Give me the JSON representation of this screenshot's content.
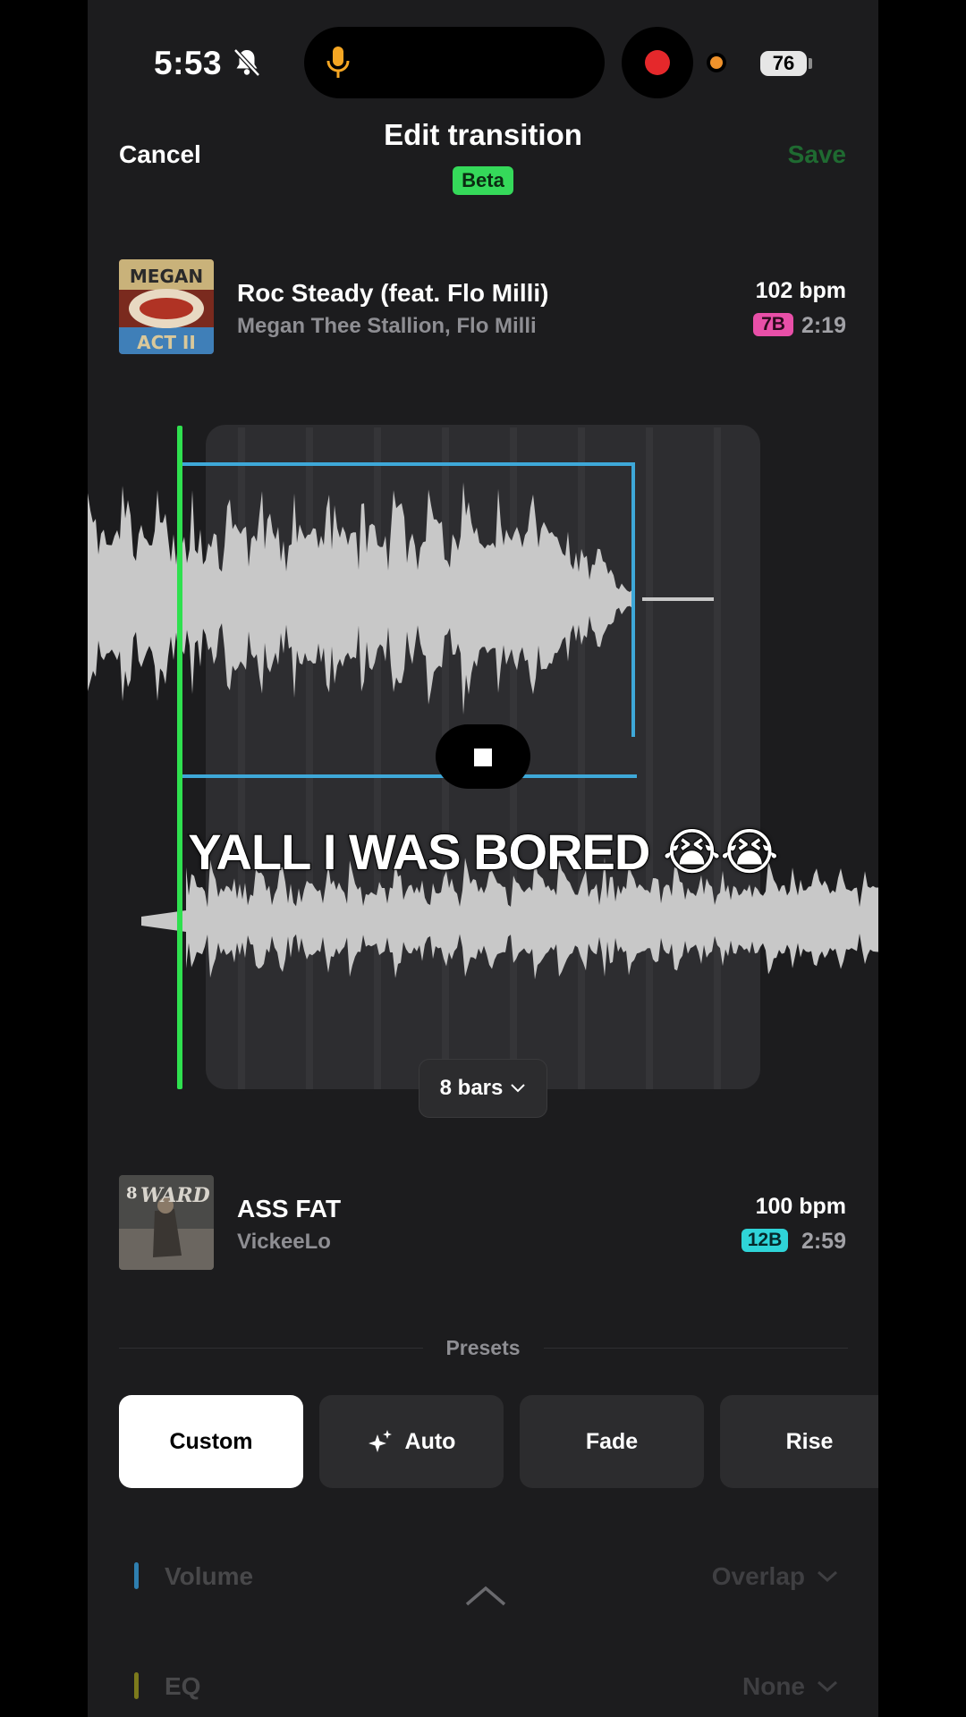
{
  "status_bar": {
    "time": "5:53",
    "battery": "76"
  },
  "header": {
    "cancel_label": "Cancel",
    "title": "Edit transition",
    "badge": "Beta",
    "save_label": "Save"
  },
  "track_out": {
    "title": "Roc Steady (feat. Flo Milli)",
    "artist": "Megan Thee Stallion, Flo Milli",
    "bpm": "102 bpm",
    "key": "7B",
    "key_color": "#e84fa8",
    "duration": "2:19"
  },
  "track_in": {
    "title": "ASS FAT",
    "artist": "VickeeLo",
    "bpm": "100 bpm",
    "key": "12B",
    "key_color": "#2fd4d8",
    "duration": "2:59"
  },
  "transition": {
    "caption": "YALL I WAS BORED 😭😭",
    "length_label": "8 bars"
  },
  "presets": {
    "label": "Presets",
    "items": [
      {
        "label": "Custom",
        "active": true
      },
      {
        "label": "Auto",
        "icon": "sparkle-icon",
        "active": false
      },
      {
        "label": "Fade",
        "active": false
      },
      {
        "label": "Rise",
        "active": false
      }
    ]
  },
  "controls": [
    {
      "label": "Volume",
      "value": "Overlap",
      "color": "#2f7fb0"
    },
    {
      "label": "EQ",
      "value": "None",
      "color": "#7c7a1c"
    }
  ],
  "colors": {
    "accent_green": "#35d95a",
    "selection_blue": "#3ea8d8",
    "playhead": "#2fe04f"
  }
}
